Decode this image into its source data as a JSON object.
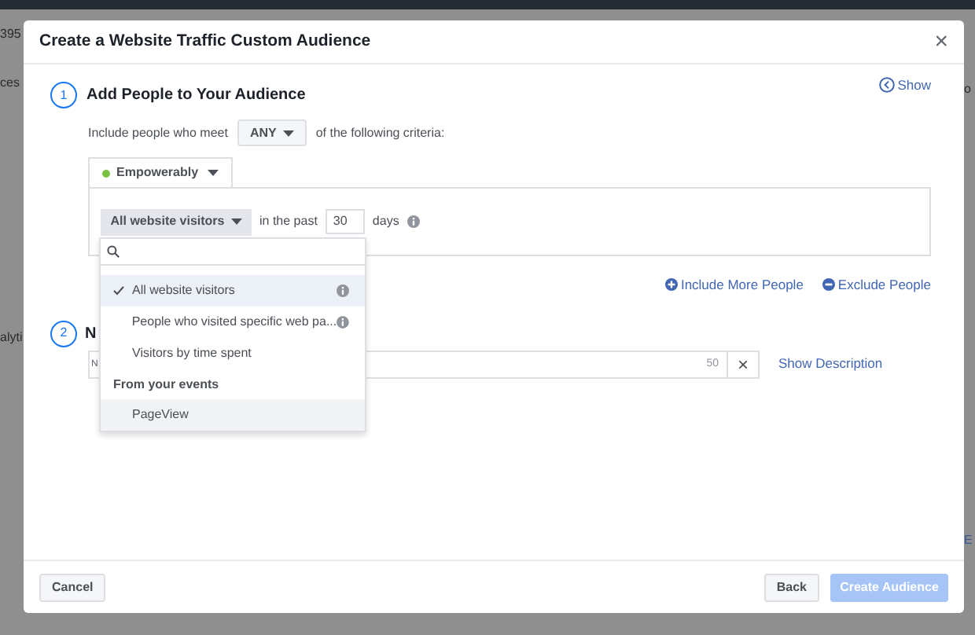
{
  "background": {
    "fragments": [
      "395",
      "ces",
      "alyti",
      "o",
      "E"
    ]
  },
  "dialog": {
    "title": "Create a Website Traffic Custom Audience",
    "close": "×"
  },
  "step1": {
    "number": "1",
    "title": "Add People to Your Audience",
    "show_link": "Show",
    "criteria": {
      "prefix": "Include people who meet",
      "match": "ANY",
      "suffix": "of the following criteria:"
    },
    "source_tab": {
      "label": "Empowerably",
      "color": "#7cc142"
    },
    "rule": {
      "selector": "All website visitors",
      "in_the_past": "in the past",
      "days_value": "30",
      "days": "days"
    },
    "dropdown": {
      "items": [
        {
          "kind": "option",
          "label": "All website visitors",
          "selected": true,
          "info": true
        },
        {
          "kind": "option",
          "label": "People who visited specific web pa...",
          "selected": false,
          "info": true
        },
        {
          "kind": "option",
          "label": "Visitors by time spent",
          "selected": false,
          "info": false
        },
        {
          "kind": "header",
          "label": "From your events"
        },
        {
          "kind": "option",
          "label": "PageView",
          "selected": false,
          "info": false,
          "hovered": true
        }
      ]
    },
    "include_more": "Include More People",
    "exclude": "Exclude People"
  },
  "step2": {
    "number": "2",
    "title": "N",
    "placeholder": "N",
    "counter": "50",
    "clear": "×",
    "show_description": "Show Description"
  },
  "footer": {
    "cancel": "Cancel",
    "back": "Back",
    "create": "Create Audience",
    "create_disabled": true
  }
}
